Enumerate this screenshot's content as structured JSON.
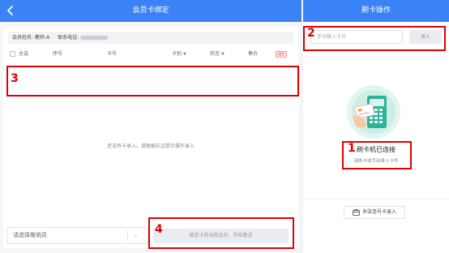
{
  "left_panel": {
    "title": "会员卡绑定",
    "info": {
      "member_name_label": "会员姓名:",
      "member_name_value": "教师-A",
      "phone_label": "联系电话:"
    },
    "table": {
      "select_all": "全选",
      "col_index": "序号",
      "col_card_no": "卡号",
      "col_card_type": "卡别",
      "col_status": "状态",
      "col_price": "售价",
      "clear_label": "清空"
    },
    "empty_text": "还没有卡录入，请根据右边提示操作录入",
    "salesperson_placeholder": "请选择推销员",
    "submit_label": "绑定卡到当前会员，开始激活"
  },
  "right_panel": {
    "title": "刷卡操作",
    "card_input_placeholder": "手动输入卡号",
    "enter_button": "录入",
    "reader_status": "刷卡机已连接",
    "reader_hint": "请刷卡或手动录入卡号",
    "multi_entry_button": "多张连号卡录入"
  },
  "annotations": [
    "1",
    "2",
    "3",
    "4"
  ],
  "colors": {
    "header_blue": "#3b82f6",
    "annotation_red": "#e00000",
    "reader_green": "#2bb39a"
  }
}
